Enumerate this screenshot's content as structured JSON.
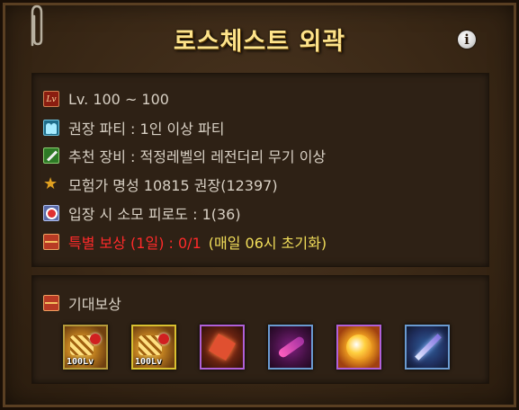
{
  "title": "로스체스트 외곽",
  "info_icon": "i",
  "info_rows": [
    {
      "icon": "level-icon",
      "icon_text": "Lv",
      "text": "Lv. 100 ~ 100",
      "color": "#d8d0c4"
    },
    {
      "icon": "party-icon",
      "text": "권장 파티 : 1인 이상 파티",
      "color": "#d8d0c4"
    },
    {
      "icon": "equipment-icon",
      "text": "추천 장비 : 적정레벨의 레전더리 무기 이상",
      "color": "#d8d0c4"
    },
    {
      "icon": "adventurer-fame-icon",
      "text": "모험가 명성 10815 권장(12397)",
      "color": "#d8d0c4"
    },
    {
      "icon": "fatigue-icon",
      "text": "입장 시 소모 피로도 : 1(36)",
      "color": "#d8d0c4"
    }
  ],
  "special_reward": {
    "icon": "treasure-chest-icon",
    "text_red": "특별 보상 (1일) : 0/1",
    "text_yellow": "(매일 06시 초기화)",
    "color_red": "#ff2a2a",
    "color_yellow": "#f2de5a"
  },
  "expected_reward": {
    "icon": "treasure-chest-icon",
    "label": "기대보상",
    "items": [
      {
        "icon": "gold-equipment-box-icon",
        "level_tag": "100Lv",
        "border": "#b59a3a"
      },
      {
        "icon": "gold-equipment-box-icon",
        "level_tag": "100Lv",
        "border": "#d8c030"
      },
      {
        "icon": "red-crystal-icon",
        "level_tag": "",
        "border": "#b060d8"
      },
      {
        "icon": "purple-shard-icon",
        "level_tag": "",
        "border": "#6a9ad0"
      },
      {
        "icon": "golden-orb-icon",
        "level_tag": "",
        "border": "#b060d8"
      },
      {
        "icon": "blue-crystal-shard-icon",
        "level_tag": "",
        "border": "#6a9ad0"
      }
    ]
  }
}
